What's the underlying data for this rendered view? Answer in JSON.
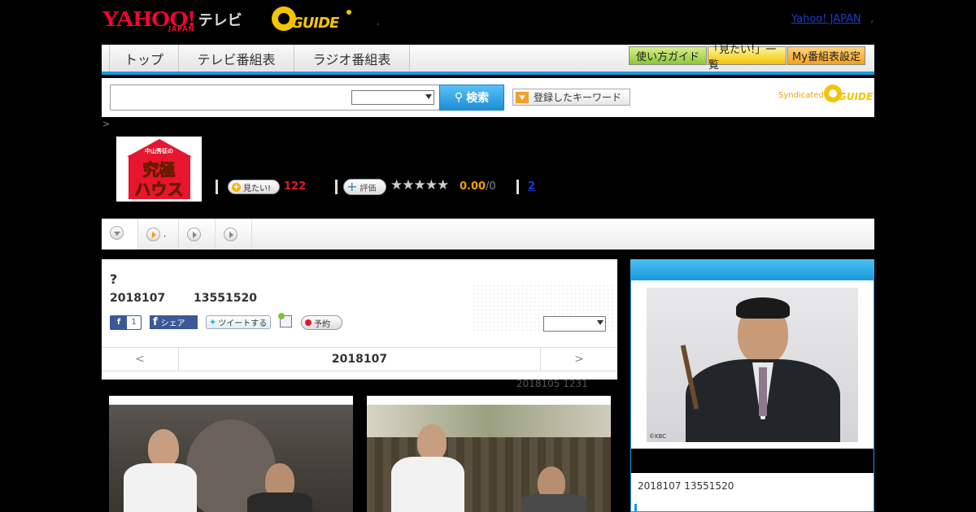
{
  "header": {
    "yahoo_logo": "YAHOO!",
    "yahoo_sub": "JAPAN",
    "tv_label": "テレビ",
    "gguide_logo": "GUIDE",
    "separator_dot": ",",
    "yahoo_japan_link": "Yahoo! JAPAN",
    "trailing_dot": ","
  },
  "nav": {
    "tabs": [
      "トップ",
      "テレビ番組表",
      "ラジオ番組表"
    ],
    "guide_button": "使い方ガイド",
    "mitai_list_button": "「見たい!」一覧",
    "my_schedule_button": "My番組表設定"
  },
  "search": {
    "input_value": "",
    "select_value": "",
    "button_label": "検索",
    "keyword_button": "登録したキーワード",
    "syndicated": "Syndicated",
    "syndicated_logo": "GUIDE"
  },
  "breadcrumb": ">",
  "program": {
    "logo_small": "中山秀征の",
    "logo_line1": "究極",
    "logo_line2": "ハウス",
    "mitai_label": "見たい!",
    "mitai_count": "122",
    "hyoka_label": "評価",
    "stars": "★★★★★",
    "rating": "0.00",
    "rating_count": "/0",
    "link_count": "2"
  },
  "subtabs": [
    {
      "label": ""
    },
    {
      "label": ","
    },
    {
      "label": ""
    },
    {
      "label": ""
    }
  ],
  "episode": {
    "title": "?",
    "date": "2018107",
    "time": "13551520",
    "fb_like_count": "1",
    "fb_share": "シェア",
    "tweet": "ツイートする",
    "yoyaku": "予約",
    "pager_prev": "<",
    "pager_date": "2018107",
    "pager_next": ">"
  },
  "update_note": "2018105  1231",
  "sidebar": {
    "credit": "©KBC",
    "date_time": "2018107  13551520"
  },
  "colors": {
    "accent_blue": "#1a9be0",
    "yahoo_red": "#ff0033",
    "gguide_yellow": "#f4c400",
    "mitai_red": "#e6162e",
    "rating_orange": "#f0a000"
  }
}
